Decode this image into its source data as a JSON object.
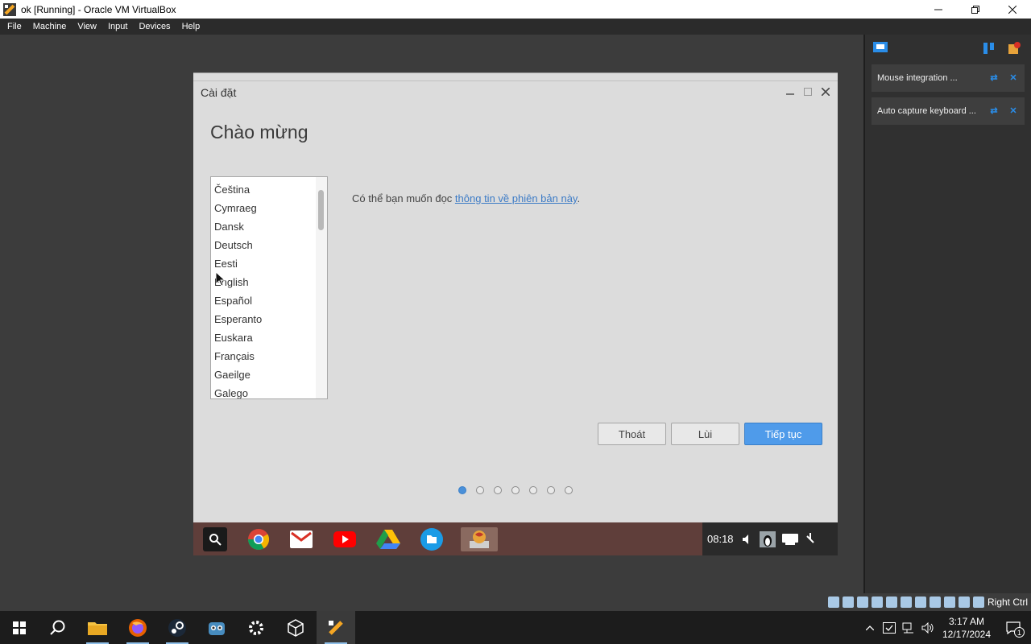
{
  "host": {
    "title": "ok [Running] - Oracle VM VirtualBox",
    "menu": [
      "File",
      "Machine",
      "View",
      "Input",
      "Devices",
      "Help"
    ],
    "statusbar_key": "Right Ctrl"
  },
  "installer": {
    "window_title": "Cài đặt",
    "heading": "Chào mừng",
    "languages": [
      "Čeština",
      "Cymraeg",
      "Dansk",
      "Deutsch",
      "Eesti",
      "English",
      "Español",
      "Esperanto",
      "Euskara",
      "Français",
      "Gaeilge",
      "Galego"
    ],
    "release_prefix": "Có thể bạn muốn đọc ",
    "release_link": "thông tin về phiên bản này",
    "release_suffix": ".",
    "buttons": {
      "quit": "Thoát",
      "back": "Lùi",
      "next": "Tiếp tục"
    },
    "steps_total": 7,
    "step_active": 1
  },
  "guest_shelf": {
    "time": "08:18"
  },
  "notifications": [
    {
      "text": "Mouse integration ..."
    },
    {
      "text": "Auto capture keyboard ..."
    }
  ],
  "taskbar": {
    "time": "3:17 AM",
    "date": "12/17/2024",
    "notification_count": "1"
  },
  "colors": {
    "accent": "#4f9bea",
    "link": "#3c7bc6",
    "shelf": "#5f3e3a"
  }
}
